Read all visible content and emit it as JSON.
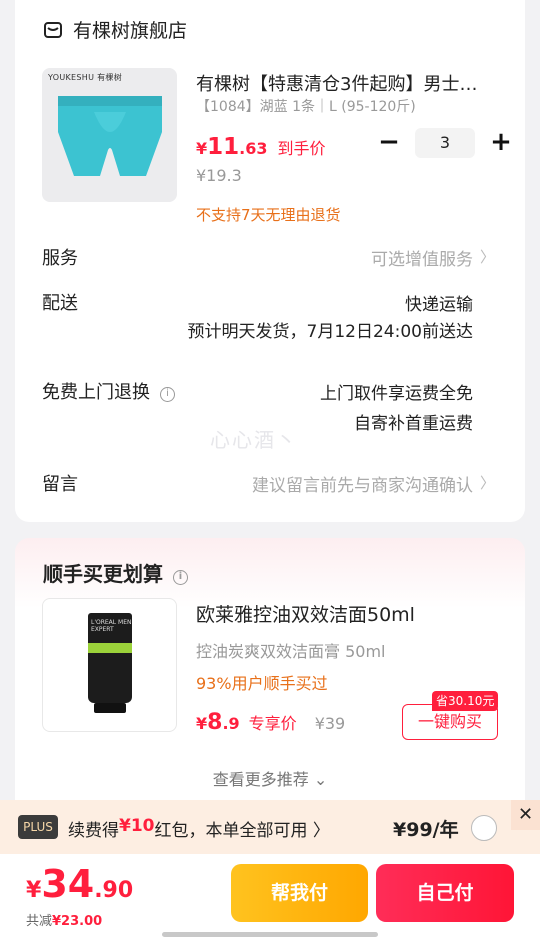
{
  "store": {
    "name": "有棵树旗舰店",
    "icon": "store-icon"
  },
  "product": {
    "brand_label": "YOUKESHU 有棵树",
    "title": "有棵树【特惠清仓3件起购】男士…",
    "spec": "【1084】湖蓝 1条｜L (95-120斤)",
    "price_yen": "¥",
    "price_int": "11",
    "price_dec": ".63",
    "price_tag": "到手价",
    "original_price": "¥19.3",
    "return_notice": "不支持7天无理由退货",
    "quantity": "3",
    "minus": "−",
    "plus": "+"
  },
  "rows": {
    "service_label": "服务",
    "service_hint": "可选增值服务",
    "delivery_label": "配送",
    "delivery_method": "快递运输",
    "delivery_eta": "预计明天发货，7月12日24:00前送达",
    "return_label": "免费上门退换",
    "return_line1": "上门取件享运费全免",
    "return_line2": "自寄补首重运费",
    "message_label": "留言",
    "message_placeholder": "建议留言前先与商家沟通确认",
    "chevron": "〉"
  },
  "watermark": "心心酒丶",
  "recommend": {
    "title": "顺手买更划算",
    "item_name": "欧莱雅控油双效洁面50ml",
    "item_sub": "控油炭爽双效洁面膏 50ml",
    "bought": "93%用户顺手买过",
    "price_yen": "¥",
    "price_int": "8",
    "price_dec": ".9",
    "price_tag": "专享价",
    "old_price": "¥39",
    "save_badge": "省30.10元",
    "buy_button": "一键购买",
    "more": "查看更多推荐 ⌄",
    "tube_logo": "L'OREAL MEN EXPERT"
  },
  "promo": {
    "badge": "PLUS",
    "text_a": "续费得",
    "text_red": "¥10",
    "text_b": "红包，本单全部可用 〉",
    "price": "¥99/年",
    "close": "✕"
  },
  "bottom": {
    "total_yen": "¥",
    "total_int": "34",
    "total_dec": ".90",
    "reduce_label": "共减",
    "reduce_amount": "¥23.00",
    "help_pay": "帮我付",
    "self_pay": "自己付"
  },
  "colors": {
    "accent": "#ff1f3d",
    "orange": "#e8701a",
    "yellow": "#ffb300"
  }
}
